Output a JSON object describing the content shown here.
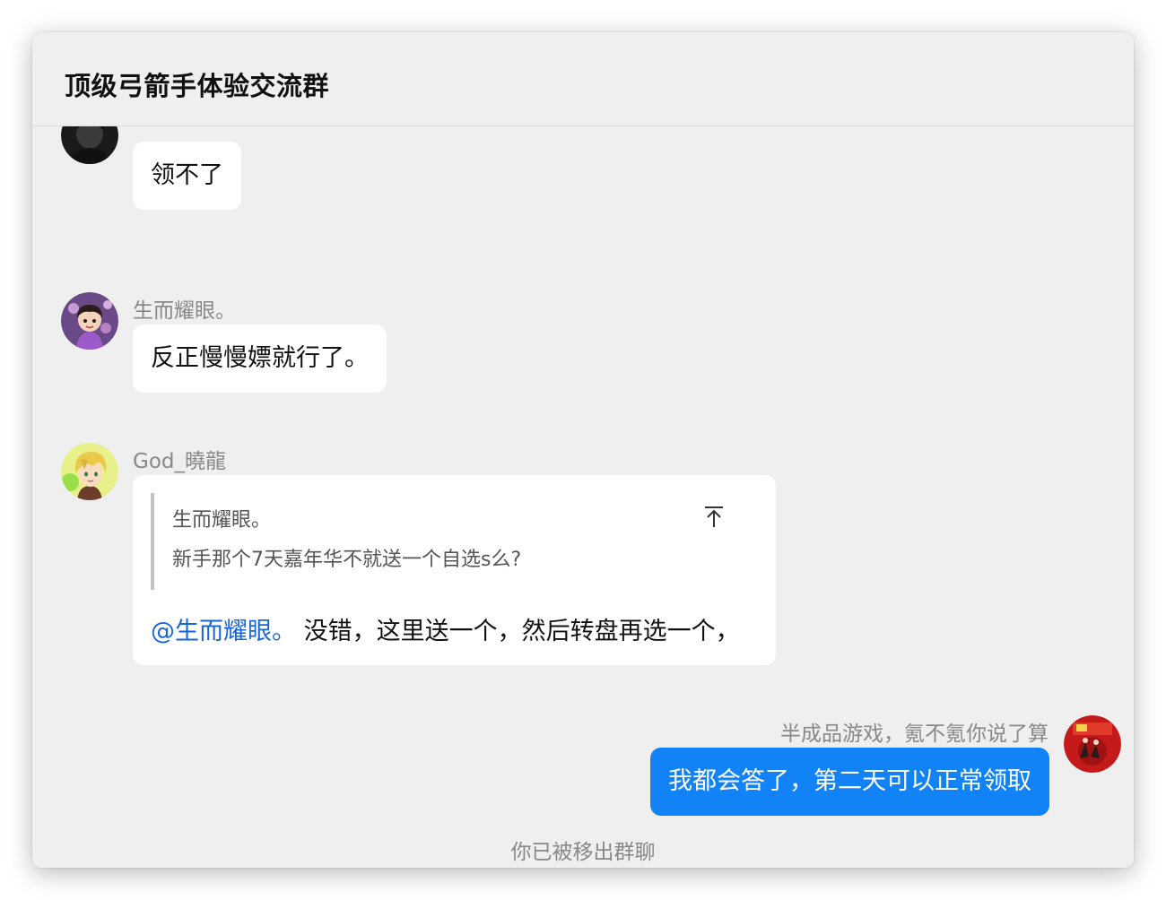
{
  "chat": {
    "title": "顶级弓箭手体验交流群"
  },
  "messages": [
    {
      "sender": "",
      "avatar": "dark-silhouette-avatar",
      "text": "领不了"
    },
    {
      "sender": "生而耀眼。",
      "avatar": "cartoon-kid-avatar",
      "text": "反正慢慢嫖就行了。"
    },
    {
      "sender": "God_曉龍",
      "avatar": "blond-anime-avatar",
      "quote": {
        "name": "生而耀眼。",
        "text": "新手那个7天嘉年华不就送一个自选s么?"
      },
      "mention": "@生而耀眼。",
      "text": " 没错，这里送一个，然后转盘再选一个，"
    },
    {
      "sender": "半成品游戏，氪不氪你说了算",
      "avatar": "red-game-avatar",
      "text": "我都会答了，第二天可以正常领取",
      "mine": true
    }
  ],
  "system_notice": "你已被移出群聊",
  "colors": {
    "window_bg": "#efefef",
    "bubble_bg": "#ffffff",
    "my_bubble_bg": "#1283f7",
    "mention": "#1a66d6",
    "meta_text": "#888888"
  }
}
